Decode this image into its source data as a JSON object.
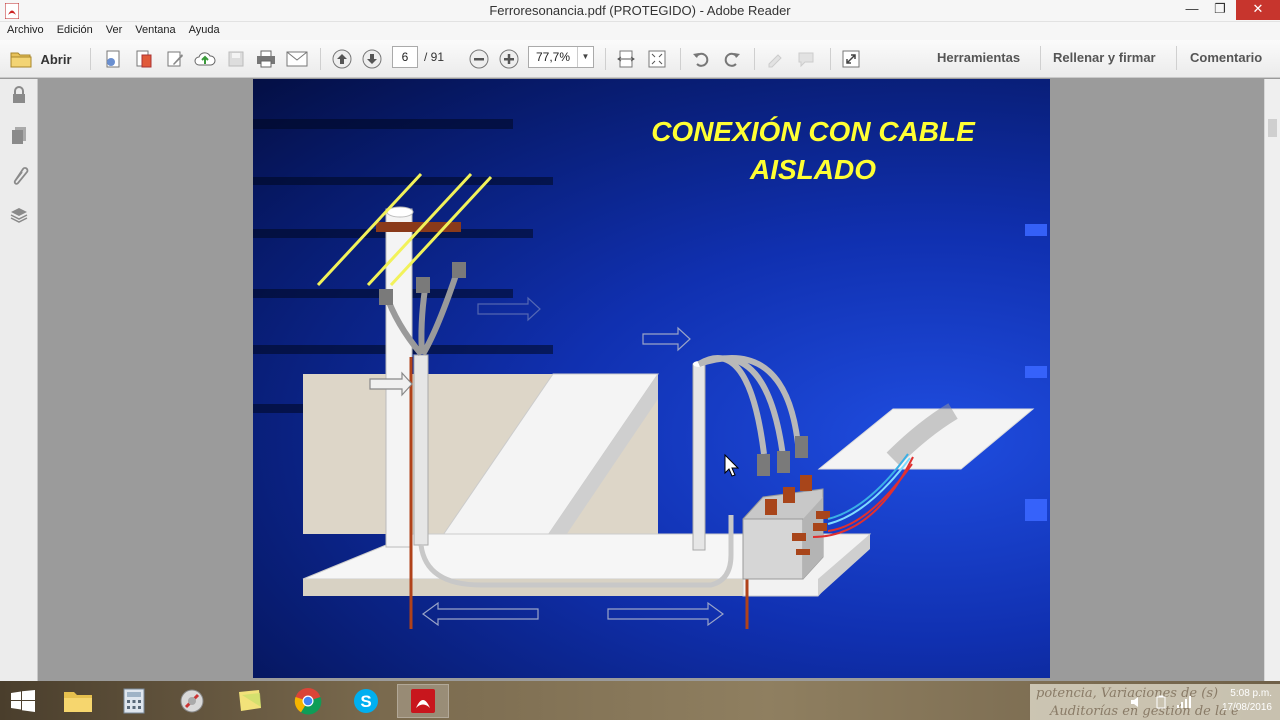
{
  "window": {
    "title": "Ferroresonancia.pdf (PROTEGIDO) - Adobe Reader"
  },
  "menu": {
    "items": [
      "Archivo",
      "Edición",
      "Ver",
      "Ventana",
      "Ayuda"
    ]
  },
  "toolbar": {
    "open_label": "Abrir",
    "page_current": "6",
    "page_total": "/ 91",
    "zoom": "77,7%",
    "tools_label": "Herramientas",
    "fill_sign_label": "Rellenar y firmar",
    "comment_label": "Comentario"
  },
  "slide": {
    "title": "CONEXIÓN CON CABLE\nAISLADO"
  },
  "taskbar": {
    "clock_time": "5:08 p.m.",
    "clock_date": "17/08/2016",
    "background_text_1": "potencia, Variaciones de (s)",
    "background_text_2": "Auditorías en gestión de la e"
  },
  "colors": {
    "slide_title": "#ffff33",
    "close_button": "#c7352d",
    "slide_blue": "#1030b0"
  }
}
